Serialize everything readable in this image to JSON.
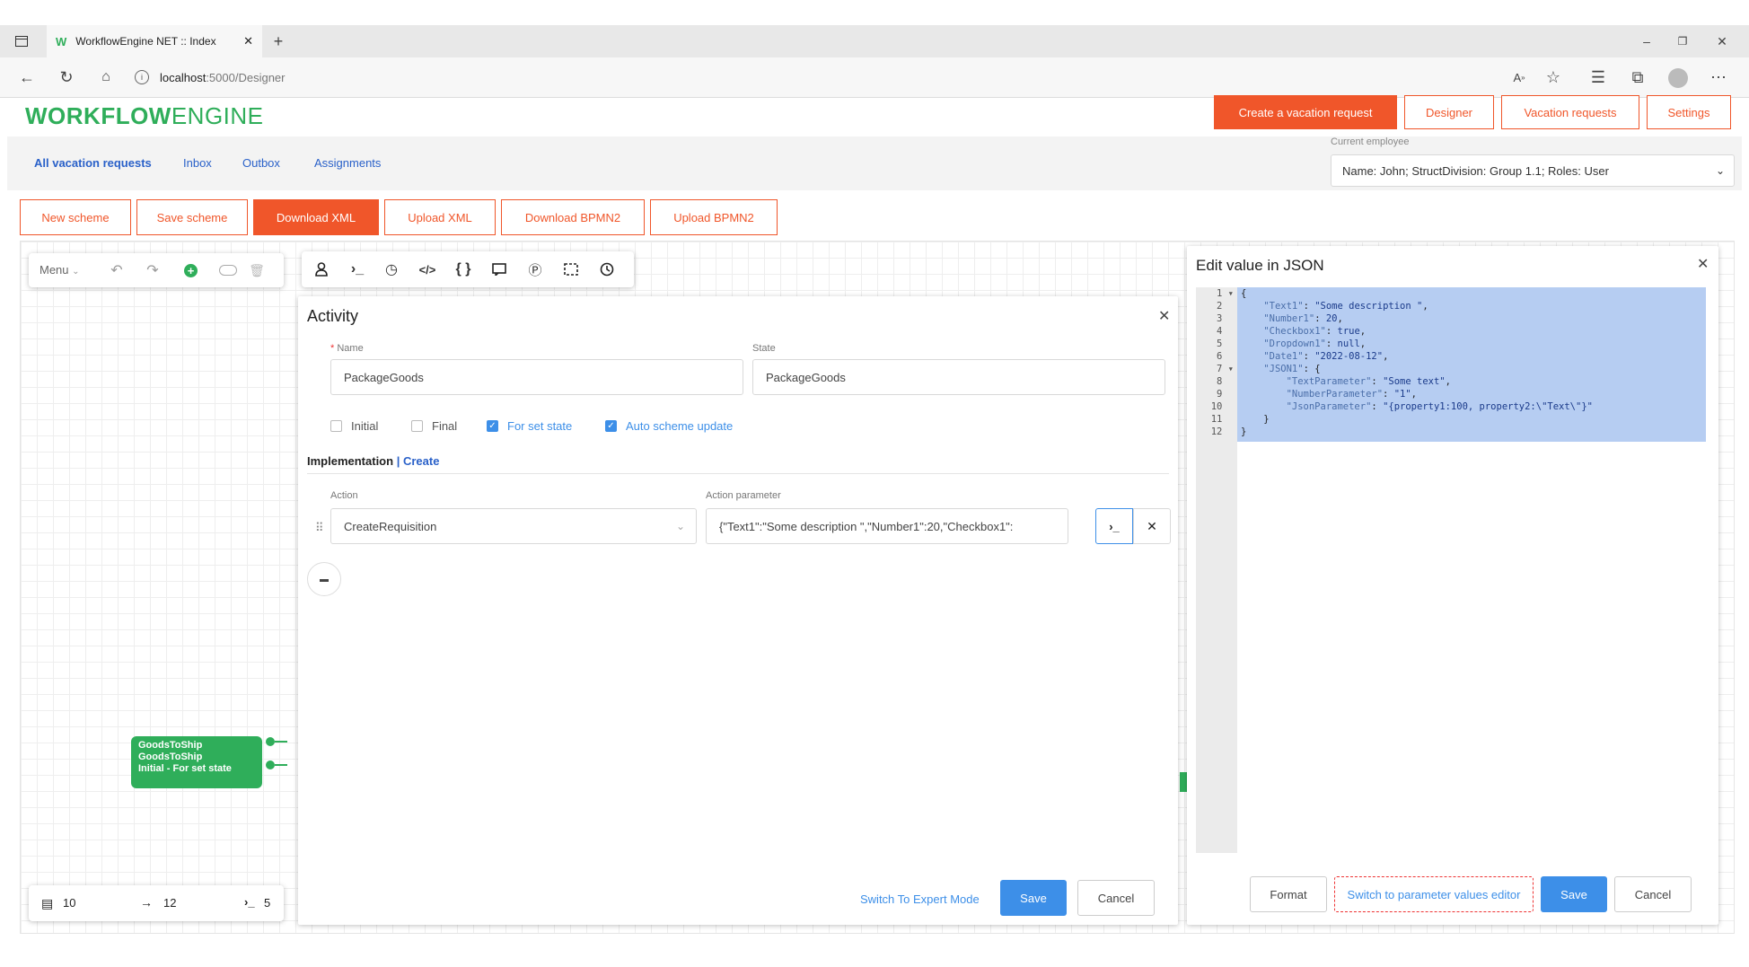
{
  "browser": {
    "tab_title": "WorkflowEngine NET :: Index",
    "url_host": "localhost",
    "url_path": ":5000/Designer"
  },
  "header": {
    "logo_bold": "WORKFLOW",
    "logo_light": "ENGINE",
    "buttons": {
      "create_vacation": "Create a vacation request",
      "designer": "Designer",
      "vacation_requests": "Vacation requests",
      "settings": "Settings"
    }
  },
  "nav": {
    "links": [
      "All vacation requests",
      "Inbox",
      "Outbox",
      "Assignments"
    ],
    "current_employee_label": "Current employee",
    "current_employee_value": "Name: John; StructDivision: Group 1.1; Roles: User"
  },
  "scheme_toolbar": {
    "new_scheme": "New scheme",
    "save_scheme": "Save scheme",
    "download_xml": "Download XML",
    "upload_xml": "Upload XML",
    "download_bpmn2": "Download BPMN2",
    "upload_bpmn2": "Upload BPMN2"
  },
  "canvas": {
    "menu_label": "Menu",
    "node": {
      "line1": "GoodsToShip",
      "line2": "GoodsToShip",
      "line3": "Initial - For set state"
    },
    "stats": {
      "activities": "10",
      "transitions": "12",
      "actions": "5"
    }
  },
  "activity_dialog": {
    "title": "Activity",
    "name_label": "Name",
    "name_required_mark": "*",
    "name_value": "PackageGoods",
    "state_label": "State",
    "state_value": "PackageGoods",
    "checkboxes": [
      {
        "label": "Initial",
        "checked": false
      },
      {
        "label": "Final",
        "checked": false
      },
      {
        "label": "For set state",
        "checked": true
      },
      {
        "label": "Auto scheme update",
        "checked": true
      }
    ],
    "implementation_label": "Implementation",
    "create_link": "Create",
    "action_label": "Action",
    "action_parameter_label": "Action parameter",
    "action_value": "CreateRequisition",
    "action_parameter_value": "{\"Text1\":\"Some description \",\"Number1\":20,\"Checkbox1\":",
    "switch_expert": "Switch To Expert Mode",
    "save": "Save",
    "cancel": "Cancel"
  },
  "json_dialog": {
    "title": "Edit value in JSON",
    "line_numbers": [
      "1",
      "2",
      "3",
      "4",
      "5",
      "6",
      "7",
      "8",
      "9",
      "10",
      "11",
      "12"
    ],
    "lines": [
      "{",
      "    \"Text1\": \"Some description \",",
      "    \"Number1\": 20,",
      "    \"Checkbox1\": true,",
      "    \"Dropdown1\": null,",
      "    \"Date1\": \"2022-08-12\",",
      "    \"JSON1\": {",
      "        \"TextParameter\": \"Some text\",",
      "        \"NumberParameter\": \"1\",",
      "        \"JsonParameter\": \"{property1:100, property2:\\\"Text\\\"}\"",
      "    }",
      "}"
    ],
    "format": "Format",
    "switch_param": "Switch to parameter values editor",
    "save": "Save",
    "cancel": "Cancel"
  },
  "colors": {
    "accent": "#f0562a",
    "link": "#2a61c9",
    "primary": "#3d8fe8",
    "node": "#2fae5a",
    "selection": "#b6cdf2"
  }
}
